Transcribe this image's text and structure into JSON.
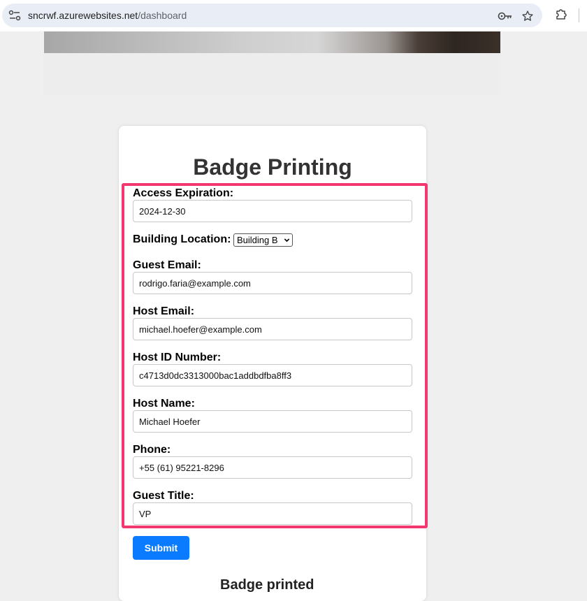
{
  "browser": {
    "url_host": "sncrwf.azurewebsites.net",
    "url_path": "/dashboard"
  },
  "form": {
    "title": "Badge Printing",
    "access_expiration": {
      "label": "Access Expiration:",
      "value": "2024-12-30"
    },
    "building_location": {
      "label": "Building Location:",
      "selected": "Building B"
    },
    "guest_email": {
      "label": "Guest Email:",
      "value": "rodrigo.faria@example.com"
    },
    "host_email": {
      "label": "Host Email:",
      "value": "michael.hoefer@example.com"
    },
    "host_id": {
      "label": "Host ID Number:",
      "value": "c4713d0dc3313000bac1addbdfba8ff3"
    },
    "host_name": {
      "label": "Host Name:",
      "value": "Michael Hoefer"
    },
    "phone": {
      "label": "Phone:",
      "value": "+55 (61) 95221-8296"
    },
    "guest_title": {
      "label": "Guest Title:",
      "value": "VP"
    },
    "submit_label": "Submit",
    "next_heading": "Badge printed"
  },
  "colors": {
    "highlight": "#f2386e",
    "submit": "#0a7bff"
  }
}
